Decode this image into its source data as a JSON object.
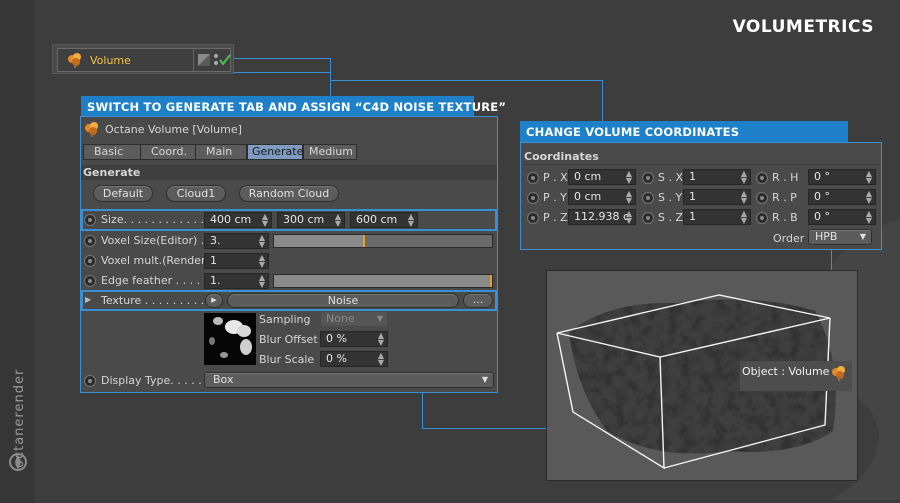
{
  "page": {
    "title": "VOLUMETRICS",
    "brand": "octanerender"
  },
  "object_tag": {
    "name": "Volume"
  },
  "attributes_panel": {
    "banner": "SWITCH TO GENERATE TAB AND ASSIGN “C4D NOISE TEXTURE”",
    "header": "Octane Volume [Volume]",
    "tabs": [
      {
        "label": "Basic"
      },
      {
        "label": "Coord."
      },
      {
        "label": "Main"
      },
      {
        "label": "Generate"
      },
      {
        "label": "Medium"
      }
    ],
    "active_tab": "Generate",
    "section": "Generate",
    "buttons": [
      {
        "label": "Default"
      },
      {
        "label": "Cloud1"
      },
      {
        "label": "Random Cloud"
      }
    ],
    "size": {
      "label": "Size. . . . . . . . . . . . . . .",
      "x": "400 cm",
      "y": "300 cm",
      "z": "600 cm"
    },
    "voxel_size": {
      "label": "Voxel Size(Editor) .",
      "value": "3.",
      "slider_fraction": 0.41
    },
    "voxel_mult": {
      "label": "Voxel mult.(Render)",
      "value": "1"
    },
    "edge_feather": {
      "label": "Edge feather . . . . .",
      "value": "1.",
      "slider_fraction": 0.99
    },
    "texture": {
      "label": "Texture . . . . . . . . . .",
      "value": "Noise",
      "more": "..."
    },
    "sampling": {
      "label": "Sampling",
      "value": "None"
    },
    "blur_offset": {
      "label": "Blur Offset",
      "value": "0 %"
    },
    "blur_scale": {
      "label": "Blur Scale",
      "value": "0 %"
    },
    "display_type": {
      "label": "Display Type. . . . . .",
      "value": "Box"
    }
  },
  "coords_panel": {
    "banner": "CHANGE VOLUME COORDINATES",
    "section": "Coordinates",
    "rows": [
      {
        "p_label": "P . X",
        "p_value": "0 cm",
        "s_label": "S . X",
        "s_value": "1",
        "r_label": "R . H",
        "r_value": "0 °"
      },
      {
        "p_label": "P . Y",
        "p_value": "0 cm",
        "s_label": "S . Y",
        "s_value": "1",
        "r_label": "R . P",
        "r_value": "0 °"
      },
      {
        "p_label": "P . Z",
        "p_value": "112.938 c",
        "s_label": "S . Z",
        "s_value": "1",
        "r_label": "R . B",
        "r_value": "0 °"
      }
    ],
    "order_label": "Order",
    "order_value": "HPB"
  },
  "viewport": {
    "object_label": "Object : Volume"
  },
  "colors": {
    "accent": "#1d80c8",
    "line": "#3a8fd6",
    "active_tab": "#7f9bc1",
    "slider_knob": "#f0a020"
  }
}
